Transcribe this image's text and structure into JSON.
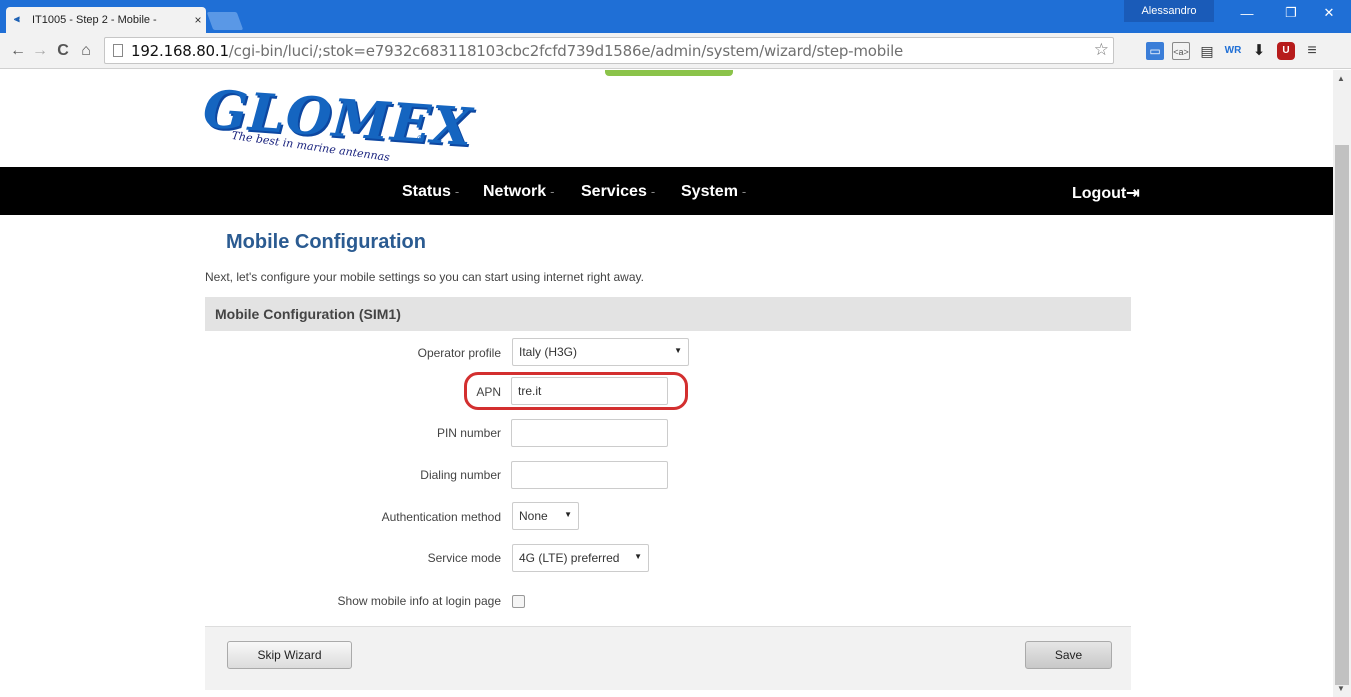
{
  "browser": {
    "tab_title": "IT1005 - Step 2 - Mobile -",
    "tab_close": "×",
    "favicon": "⫷",
    "user": "Alessandro",
    "window_min": "—",
    "window_max": "❐",
    "window_close": "✕",
    "url_host": "192.168.80.1",
    "url_path": "/cgi-bin/luci/;stok=e7932c683118103cbc2fcfd739d1586e/admin/system/wizard/step-mobile",
    "nav_back": "←",
    "nav_forward": "→",
    "nav_reload": "C",
    "nav_home": "⌂",
    "bookmark_star": "☆",
    "extensions": [
      "▭",
      "<a>",
      "▤",
      "WR",
      "⬇",
      "U",
      "≡"
    ]
  },
  "logo": {
    "word": "GLOMEX",
    "tagline": "The best in marine antennas",
    "reg": "®"
  },
  "menu": {
    "status": "Status",
    "network": "Network",
    "services": "Services",
    "system": "System",
    "caret": "-",
    "logout": "Logout",
    "logout_icon": "⇥"
  },
  "page": {
    "title": "Mobile Configuration",
    "intro": "Next, let's configure your mobile settings so you can start using internet right away.",
    "section": "Mobile Configuration (SIM1)"
  },
  "form": {
    "operator_profile": {
      "label": "Operator profile",
      "value": "Italy (H3G)"
    },
    "apn": {
      "label": "APN",
      "value": "tre.it"
    },
    "pin": {
      "label": "PIN number",
      "value": ""
    },
    "dialing": {
      "label": "Dialing number",
      "value": ""
    },
    "auth": {
      "label": "Authentication method",
      "value": "None"
    },
    "service_mode": {
      "label": "Service mode",
      "value": "4G (LTE) preferred"
    },
    "show_info": {
      "label": "Show mobile info at login page",
      "checked": false
    },
    "select_arrow": "▼"
  },
  "buttons": {
    "skip": "Skip Wizard",
    "save": "Save"
  },
  "scroll": {
    "up": "▲",
    "down": "▼"
  },
  "colors": {
    "titlebar": "#1f6fd6",
    "menubar": "#000000",
    "page_title": "#2b5b91",
    "highlight": "#d32f2f"
  }
}
